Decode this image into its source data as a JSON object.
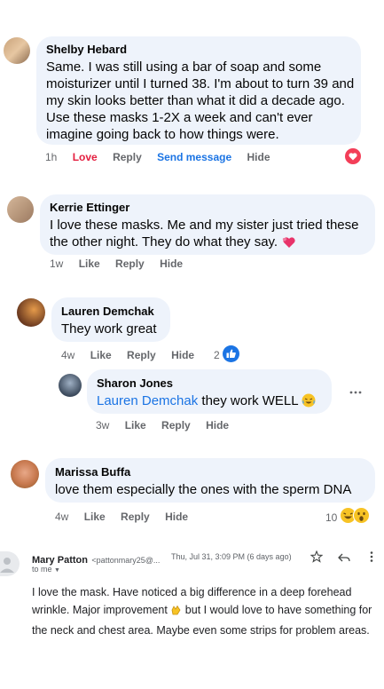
{
  "comments": [
    {
      "author": "Shelby Hebard",
      "text": "Same. I was still using a bar of soap and some moisturizer until I turned 38. I'm about to turn 39 and my skin looks better than what it did a decade ago. Use these masks 1-2X a week and can't ever imagine going back to how things were.",
      "time": "1h",
      "actions": [
        "Love",
        "Reply",
        "Send message",
        "Hide"
      ]
    },
    {
      "author": "Kerrie Ettinger",
      "text": "I love these masks. Me and my sister just tried these the other night. They do what they say.",
      "time": "1w",
      "actions": [
        "Like",
        "Reply",
        "Hide"
      ]
    },
    {
      "author": "Lauren Demchak",
      "text": "They work great",
      "time": "4w",
      "actions": [
        "Like",
        "Reply",
        "Hide"
      ],
      "reaction_count": "2"
    },
    {
      "author": "Sharon Jones",
      "mention": "Lauren Demchak",
      "text": "they work WELL",
      "time": "3w",
      "actions": [
        "Like",
        "Reply",
        "Hide"
      ]
    },
    {
      "author": "Marissa Buffa",
      "text": "love them especially the ones with the sperm DNA",
      "time": "4w",
      "actions": [
        "Like",
        "Reply",
        "Hide"
      ],
      "reaction_count": "10"
    }
  ],
  "email": {
    "sender": "Mary Patton",
    "address": "<pattonmary25@...",
    "date": "Thu, Jul 31, 3:09 PM (6 days ago)",
    "to": "to me",
    "body_1": "I love the mask. Have noticed a big difference in a deep forehead wrinkle.  Major improvement",
    "body_2": " but I would love to have something for the neck and chest area. Maybe even some strips for problem areas."
  },
  "colors": {
    "link_blue": "#1b74e4",
    "love_red": "#e41e3f",
    "bubble": "#eef3fb",
    "meta_gray": "#65676b"
  }
}
